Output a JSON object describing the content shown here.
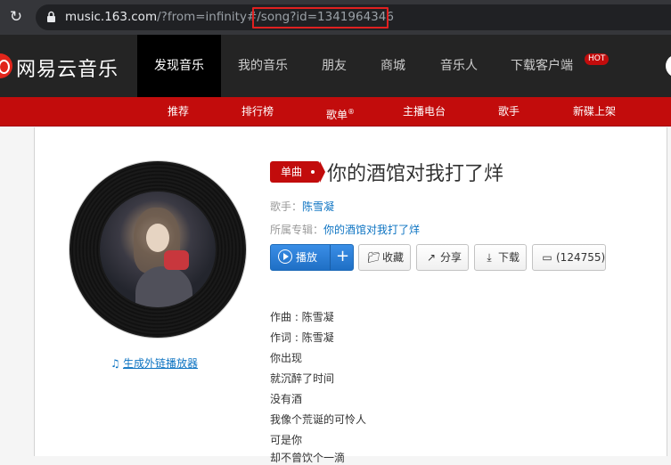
{
  "browser": {
    "url_domain": "music.163.com",
    "url_path": "/?from=infinity#/song?id=",
    "url_id": "1341964346"
  },
  "topnav": {
    "logo": "网易云音乐",
    "items": [
      "发现音乐",
      "我的音乐",
      "朋友",
      "商城",
      "音乐人",
      "下载客户端"
    ],
    "hot_badge": "HOT"
  },
  "subnav": {
    "items": [
      "推荐",
      "排行榜",
      "歌单",
      "主播电台",
      "歌手",
      "新碟上架"
    ],
    "registered_mark": "®"
  },
  "song": {
    "type_badge": "单曲",
    "title": "你的酒馆对我打了烊",
    "singer_label": "歌手：",
    "singer": "陈雪凝",
    "album_label": "所属专辑：",
    "album": "你的酒馆对我打了烊",
    "gen_link": "生成外链播放器"
  },
  "actions": {
    "play": "播放",
    "add": "+",
    "collect": "收藏",
    "share": "分享",
    "download": "下载",
    "comments": "(124755)"
  },
  "lyrics": [
    "作曲 : 陈雪凝",
    "作词 : 陈雪凝",
    "你出现",
    "就沉醉了时间",
    "没有酒",
    "我像个荒诞的可怜人",
    "可是你",
    "却不曾饮个一滴"
  ],
  "colors": {
    "brand_red": "#c20c0c",
    "nav_dark": "#242424",
    "link_blue": "#0c73c2",
    "play_blue": "#2a7fd6"
  }
}
